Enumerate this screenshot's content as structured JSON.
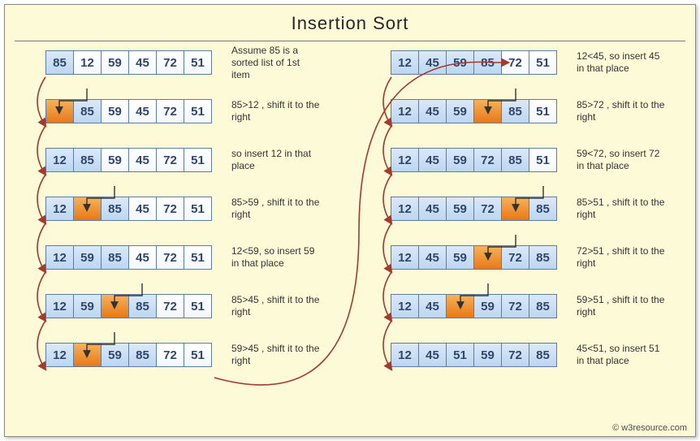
{
  "title": "Insertion  Sort",
  "credit": "© w3resource.com",
  "left": [
    {
      "cells": [
        "85",
        "12",
        "59",
        "45",
        "72",
        "51"
      ],
      "state": [
        "s",
        "",
        "",
        "",
        "",
        ""
      ],
      "desc": "Assume 85 is a sorted list of 1st item"
    },
    {
      "cells": [
        "",
        "85",
        "59",
        "45",
        "72",
        "51"
      ],
      "state": [
        "a",
        "s",
        "",
        "",
        "",
        ""
      ],
      "desc": "85>12 , shift it to the right"
    },
    {
      "cells": [
        "12",
        "85",
        "59",
        "45",
        "72",
        "51"
      ],
      "state": [
        "s",
        "s",
        "",
        "",
        "",
        ""
      ],
      "desc": "so insert 12 in that place"
    },
    {
      "cells": [
        "12",
        "",
        "85",
        "45",
        "72",
        "51"
      ],
      "state": [
        "s",
        "a",
        "s",
        "",
        "",
        ""
      ],
      "desc": "85>59 , shift it to the right"
    },
    {
      "cells": [
        "12",
        "59",
        "85",
        "45",
        "72",
        "51"
      ],
      "state": [
        "s",
        "s",
        "s",
        "",
        "",
        ""
      ],
      "desc": "12<59, so insert 59 in that place"
    },
    {
      "cells": [
        "12",
        "59",
        "",
        "85",
        "72",
        "51"
      ],
      "state": [
        "s",
        "s",
        "a",
        "s",
        "",
        ""
      ],
      "desc": "85>45 , shift it to the right"
    },
    {
      "cells": [
        "12",
        "",
        "59",
        "85",
        "72",
        "51"
      ],
      "state": [
        "s",
        "a",
        "s",
        "s",
        "",
        ""
      ],
      "desc": "59>45 , shift it to the right"
    }
  ],
  "right": [
    {
      "cells": [
        "12",
        "45",
        "59",
        "85",
        "72",
        "51"
      ],
      "state": [
        "s",
        "s",
        "s",
        "s",
        "",
        ""
      ],
      "desc": "12<45, so insert 45 in that place"
    },
    {
      "cells": [
        "12",
        "45",
        "59",
        "",
        "85",
        "51"
      ],
      "state": [
        "s",
        "s",
        "s",
        "a",
        "s",
        ""
      ],
      "desc": "85>72 , shift it to the right"
    },
    {
      "cells": [
        "12",
        "45",
        "59",
        "72",
        "85",
        "51"
      ],
      "state": [
        "s",
        "s",
        "s",
        "s",
        "s",
        ""
      ],
      "desc": "59<72, so insert 72 in that place"
    },
    {
      "cells": [
        "12",
        "45",
        "59",
        "72",
        "",
        "85"
      ],
      "state": [
        "s",
        "s",
        "s",
        "s",
        "a",
        "s"
      ],
      "desc": "85>51 , shift it to the right"
    },
    {
      "cells": [
        "12",
        "45",
        "59",
        "",
        "72",
        "85"
      ],
      "state": [
        "s",
        "s",
        "s",
        "a",
        "s",
        "s"
      ],
      "desc": "72>51 , shift it to the right"
    },
    {
      "cells": [
        "12",
        "45",
        "",
        "59",
        "72",
        "85"
      ],
      "state": [
        "s",
        "s",
        "a",
        "s",
        "s",
        "s"
      ],
      "desc": "59>51 , shift it to the right"
    },
    {
      "cells": [
        "12",
        "45",
        "51",
        "59",
        "72",
        "85"
      ],
      "state": [
        "s",
        "s",
        "s",
        "s",
        "s",
        "s"
      ],
      "desc": "45<51, so insert 51 in that place"
    }
  ],
  "chart_data": {
    "type": "table",
    "title": "Insertion Sort step-by-step",
    "initial": [
      85,
      12,
      59,
      45,
      72,
      51
    ],
    "sorted": [
      12,
      45,
      51,
      59,
      72,
      85
    ],
    "steps": [
      {
        "array": [
          85,
          12,
          59,
          45,
          72,
          51
        ],
        "note": "Assume 85 is a sorted list of 1st item"
      },
      {
        "array": [
          null,
          85,
          59,
          45,
          72,
          51
        ],
        "note": "85>12 shift right",
        "gap_index": 0
      },
      {
        "array": [
          12,
          85,
          59,
          45,
          72,
          51
        ],
        "note": "insert 12"
      },
      {
        "array": [
          12,
          null,
          85,
          45,
          72,
          51
        ],
        "note": "85>59 shift right",
        "gap_index": 1
      },
      {
        "array": [
          12,
          59,
          85,
          45,
          72,
          51
        ],
        "note": "12<59 insert 59"
      },
      {
        "array": [
          12,
          59,
          null,
          85,
          72,
          51
        ],
        "note": "85>45 shift right",
        "gap_index": 2
      },
      {
        "array": [
          12,
          null,
          59,
          85,
          72,
          51
        ],
        "note": "59>45 shift right",
        "gap_index": 1
      },
      {
        "array": [
          12,
          45,
          59,
          85,
          72,
          51
        ],
        "note": "12<45 insert 45"
      },
      {
        "array": [
          12,
          45,
          59,
          null,
          85,
          51
        ],
        "note": "85>72 shift right",
        "gap_index": 3
      },
      {
        "array": [
          12,
          45,
          59,
          72,
          85,
          51
        ],
        "note": "59<72 insert 72"
      },
      {
        "array": [
          12,
          45,
          59,
          72,
          null,
          85
        ],
        "note": "85>51 shift right",
        "gap_index": 4
      },
      {
        "array": [
          12,
          45,
          59,
          null,
          72,
          85
        ],
        "note": "72>51 shift right",
        "gap_index": 3
      },
      {
        "array": [
          12,
          45,
          null,
          59,
          72,
          85
        ],
        "note": "59>51 shift right",
        "gap_index": 2
      },
      {
        "array": [
          12,
          45,
          51,
          59,
          72,
          85
        ],
        "note": "45<51 insert 51"
      }
    ]
  }
}
